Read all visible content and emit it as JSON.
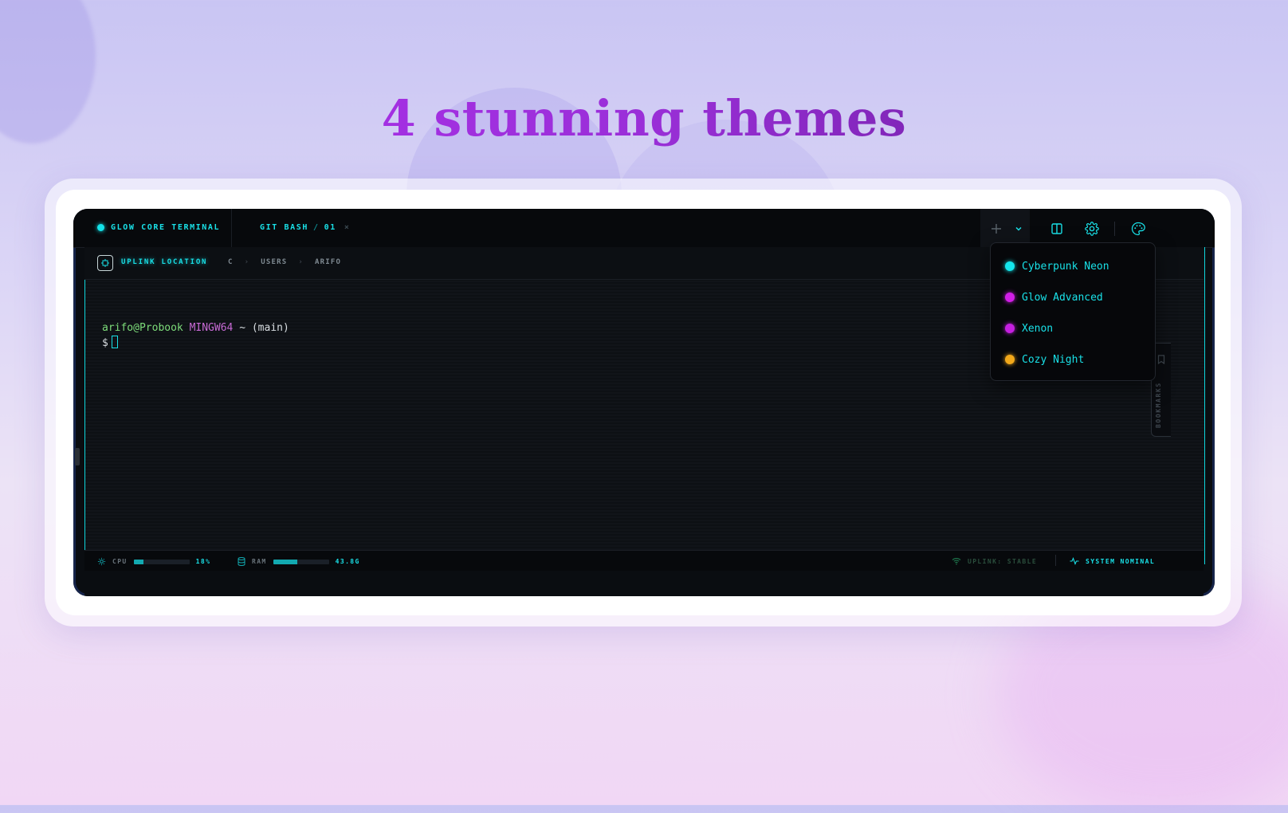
{
  "headline": "4 stunning themes",
  "terminal": {
    "brand": "GLOW CORE TERMINAL",
    "tab": {
      "name": "GIT BASH",
      "number": "01",
      "close": "×"
    },
    "toolbar": [
      "plus-icon",
      "chevron-down-icon",
      "split-pane-icon",
      "gear-icon",
      "palette-icon"
    ]
  },
  "path": {
    "label": "UPLINK LOCATION",
    "crumbs": [
      "C",
      "USERS",
      "ARIFO"
    ],
    "separator": "›"
  },
  "prompt": {
    "user_host": "arifo@Probook",
    "env": "MINGW64",
    "rest": "~ (main)",
    "symbol": "$"
  },
  "bookmarks": {
    "label": "BOOKMARKS"
  },
  "theme_menu": {
    "items": [
      {
        "label": "Cyberpunk Neon",
        "color": "#14e6ec"
      },
      {
        "label": "Glow Advanced",
        "color": "#d11ee6"
      },
      {
        "label": "Xenon",
        "color": "#c51fe0"
      },
      {
        "label": "Cozy Night",
        "color": "#f2a81a"
      }
    ]
  },
  "status": {
    "cpu_label": "CPU",
    "cpu_value": "18%",
    "cpu_fraction": 0.18,
    "ram_label": "RAM",
    "ram_value": "43.8G",
    "ram_fraction": 0.44,
    "uplink": "UPLINK: STABLE",
    "system": "SYSTEM NOMINAL"
  },
  "colors": {
    "accent": "#19e0e7",
    "background": "#0a0d11"
  }
}
